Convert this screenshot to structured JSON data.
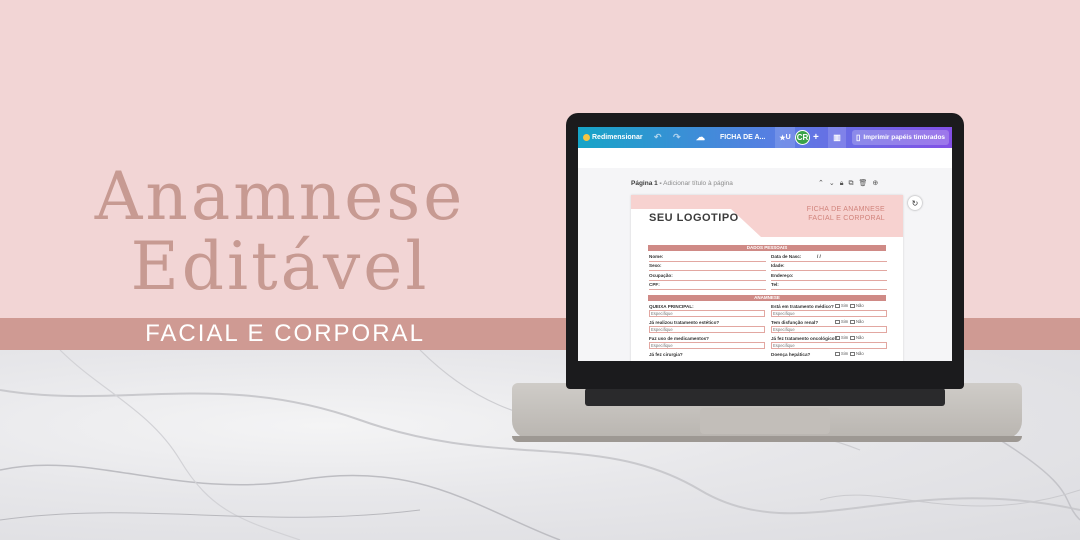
{
  "hero": {
    "title_line1": "Anamnese",
    "title_line2": "Editável",
    "subtitle": "FACIAL E CORPORAL"
  },
  "editor": {
    "toolbar": {
      "resize_label": "Redimensionar",
      "file_label": "FICHA DE A...",
      "star_label": "U",
      "avatar_initials": "CR",
      "add_label": "+",
      "print_label": "Imprimir papéis timbrados"
    },
    "page": {
      "page_label": "Página 1 -",
      "add_title_label": "Adicionar título à página"
    }
  },
  "document": {
    "logo": "SEU LOGOTIPO",
    "form_title": "FICHA DE ANAMNESE",
    "form_subtitle": "FACIAL E CORPORAL",
    "personal_section": "DADOS PESSOAIS",
    "personal_fields_left": [
      "Nome:",
      "Sexo:",
      "Ocupação:",
      "CPF:"
    ],
    "personal_fields_right": [
      "Data de Nasc:",
      "Idade:",
      "Endereço:",
      "Tel:"
    ],
    "date_slashes": "/    /",
    "anamnese_section": "ANAMNESE",
    "questions_left": [
      "QUEIXA PRINCIPAL:",
      "Já realizou tratamento estético?",
      "Faz uso de medicamentos?",
      "Já fez cirurgia?"
    ],
    "questions_right": [
      "Está em tratamento médico?",
      "Tem disfunção renal?",
      "Já fez tratamento oncológico?",
      "Doença hepática?"
    ],
    "specify_placeholder": "Especifique",
    "yes_label": "Sim",
    "no_label": "Não"
  },
  "colors": {
    "background_pink": "#f2d5d5",
    "band_rose": "#cf9a93",
    "title_rose": "#c79a92",
    "toolbar_gradient_start": "#16a4c7",
    "toolbar_gradient_end": "#8350e6",
    "section_bar": "#cf8a86"
  }
}
